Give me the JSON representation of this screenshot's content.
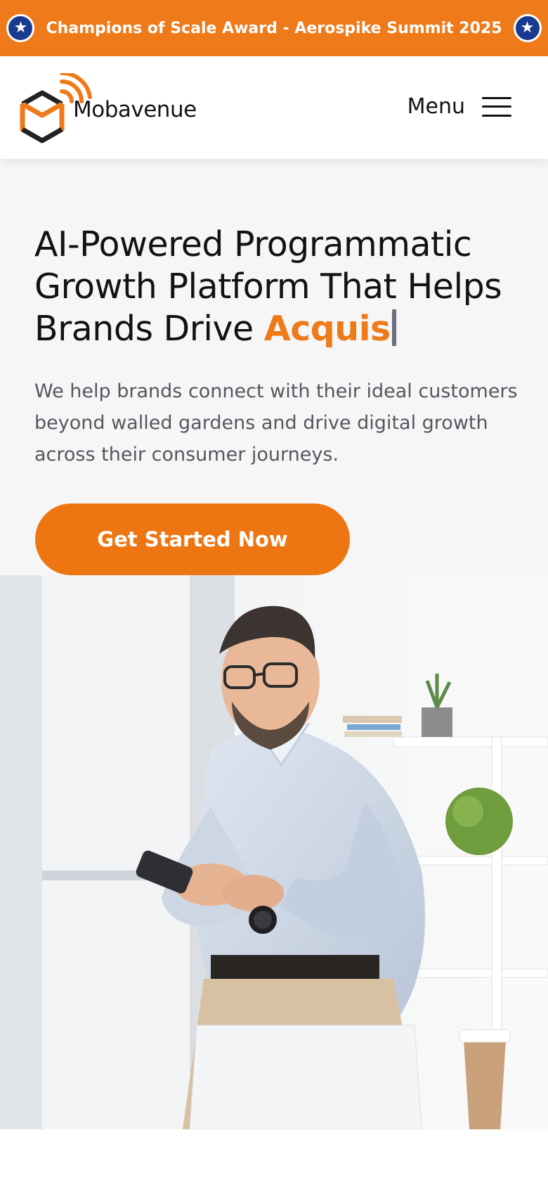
{
  "announcement": {
    "text": "Champions of Scale Award - Aerospike Summit 2025",
    "left_icon": "star-icon",
    "right_icon": "star-icon",
    "background": "#ef7a1a",
    "badge_color": "#1a3a8f"
  },
  "header": {
    "logo_text": "Mobavenue",
    "menu_label": "Menu",
    "menu_icon": "hamburger-icon"
  },
  "hero": {
    "headline_main": "AI-Powered Programmatic Growth Platform That Helps Brands Drive ",
    "headline_accent": "Acquis",
    "subtext": "We help brands connect with their ideal customers beyond walled gardens and drive digital growth across their consumer journeys.",
    "cta_label": "Get Started Now",
    "accent_color": "#ef7a1a",
    "image": "man-smiling-at-phone-in-office-photo"
  }
}
